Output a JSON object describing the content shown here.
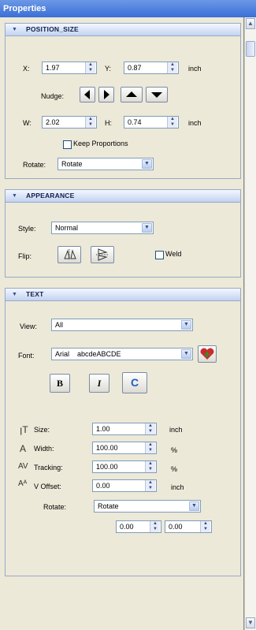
{
  "window": {
    "title": "Properties"
  },
  "position_size": {
    "title": "POSITION_SIZE",
    "x_label": "X:",
    "x_value": "1.97",
    "y_label": "Y:",
    "y_value": "0.87",
    "pos_unit": "inch",
    "nudge_label": "Nudge:",
    "w_label": "W:",
    "w_value": "2.02",
    "h_label": "H:",
    "h_value": "0.74",
    "size_unit": "inch",
    "keep_proportions_label": "Keep Proportions",
    "keep_proportions_checked": false,
    "rotate_label": "Rotate:",
    "rotate_value": "Rotate"
  },
  "appearance": {
    "title": "APPEARANCE",
    "style_label": "Style:",
    "style_value": "Normal",
    "flip_label": "Flip:",
    "weld_label": "Weld",
    "weld_checked": false
  },
  "text": {
    "title": "TEXT",
    "view_label": "View:",
    "view_value": "All",
    "font_label": "Font:",
    "font_value": "Arial    abcdeABCDE",
    "bold_label": "B",
    "italic_label": "I",
    "reset_label": "C",
    "size_label": "Size:",
    "size_value": "1.00",
    "size_unit": "inch",
    "width_label": "Width:",
    "width_value": "100.00",
    "width_unit": "%",
    "tracking_label": "Tracking:",
    "tracking_value": "100.00",
    "tracking_unit": "%",
    "voffset_label": "V Offset:",
    "voffset_value": "0.00",
    "voffset_unit": "inch",
    "rotate_label": "Rotate:",
    "rotate_value": "Rotate",
    "rot_a_value": "0.00",
    "rot_b_value": "0.00"
  },
  "icons": {
    "spin": "up-down-spinner-icon",
    "dropdown": "chevron-down-icon",
    "nudge": [
      "arrow-left-icon",
      "arrow-right-icon",
      "arrow-up-icon",
      "arrow-down-icon"
    ],
    "flip": [
      "flip-horizontal-icon",
      "flip-vertical-icon"
    ],
    "favorite": "heart-plus-icon"
  },
  "colors": {
    "title_bar": "#3a6fd6",
    "section_header": "#c2d2f1",
    "panel_bg": "#ece9d8"
  }
}
